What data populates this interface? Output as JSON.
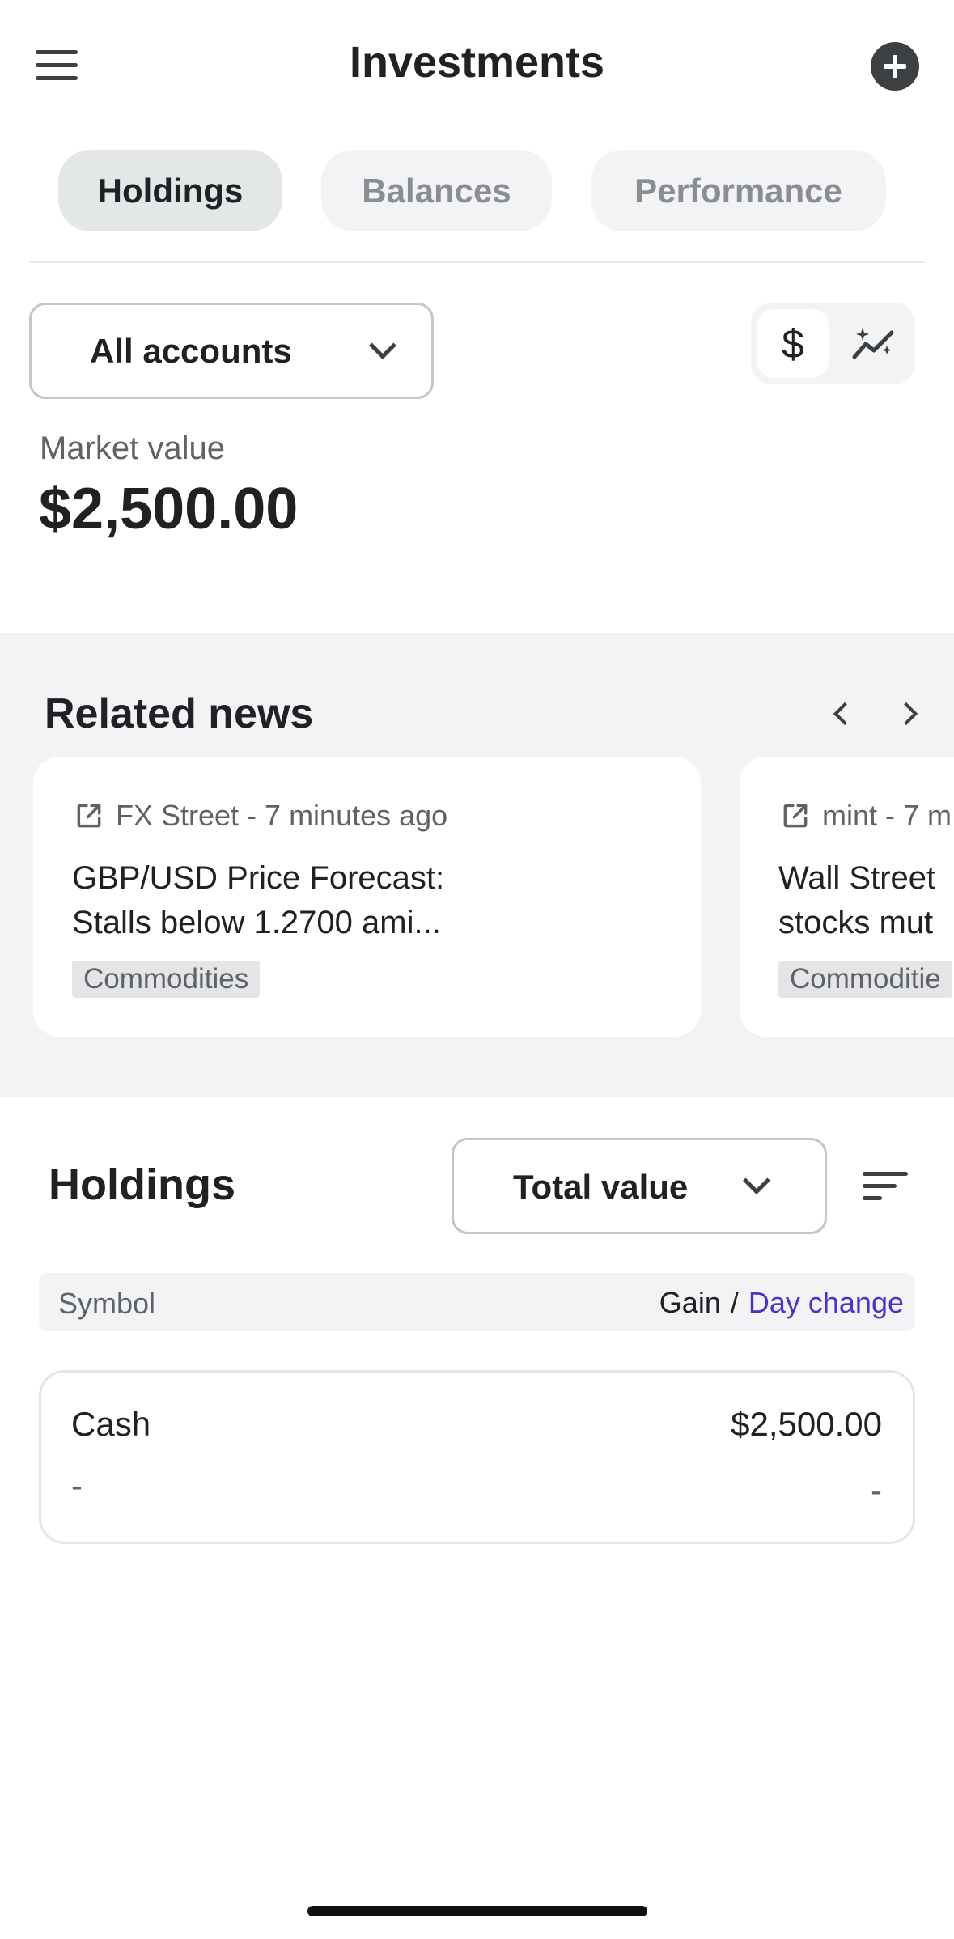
{
  "header": {
    "title": "Investments",
    "menu_icon": "hamburger-menu-icon",
    "add_icon": "plus-circle-icon"
  },
  "tabs": [
    {
      "label": "Holdings",
      "active": true
    },
    {
      "label": "Balances",
      "active": false
    },
    {
      "label": "Performance",
      "active": false
    }
  ],
  "account_filter": {
    "selected": "All accounts"
  },
  "view_toggle": {
    "dollar_symbol": "$",
    "dollar_icon": "dollar-sign-icon",
    "trend_icon": "sparkle-trend-icon",
    "selected": "dollar"
  },
  "market_value": {
    "label": "Market value",
    "value": "$2,500.00"
  },
  "news": {
    "title": "Related news",
    "items": [
      {
        "source": "FX Street - 7 minutes ago",
        "headline_line1": "GBP/USD Price Forecast:",
        "headline_line2": "Stalls below 1.2700 ami...",
        "tag": "Commodities"
      },
      {
        "source": "mint - 7 m",
        "headline_line1": "Wall Street",
        "headline_line2": "stocks mut",
        "tag": "Commoditie"
      }
    ]
  },
  "holdings": {
    "title": "Holdings",
    "sort_select": "Total value",
    "columns": {
      "symbol": "Symbol",
      "gain": "Gain",
      "separator": "/",
      "day_change": "Day change"
    },
    "rows": [
      {
        "name": "Cash",
        "value": "$2,500.00",
        "gain": "-",
        "day_change": "-"
      }
    ]
  },
  "colors": {
    "accent_link": "#4a34c8",
    "active_tab": "#e3e7e8",
    "section_bg": "#f1f3f4"
  }
}
